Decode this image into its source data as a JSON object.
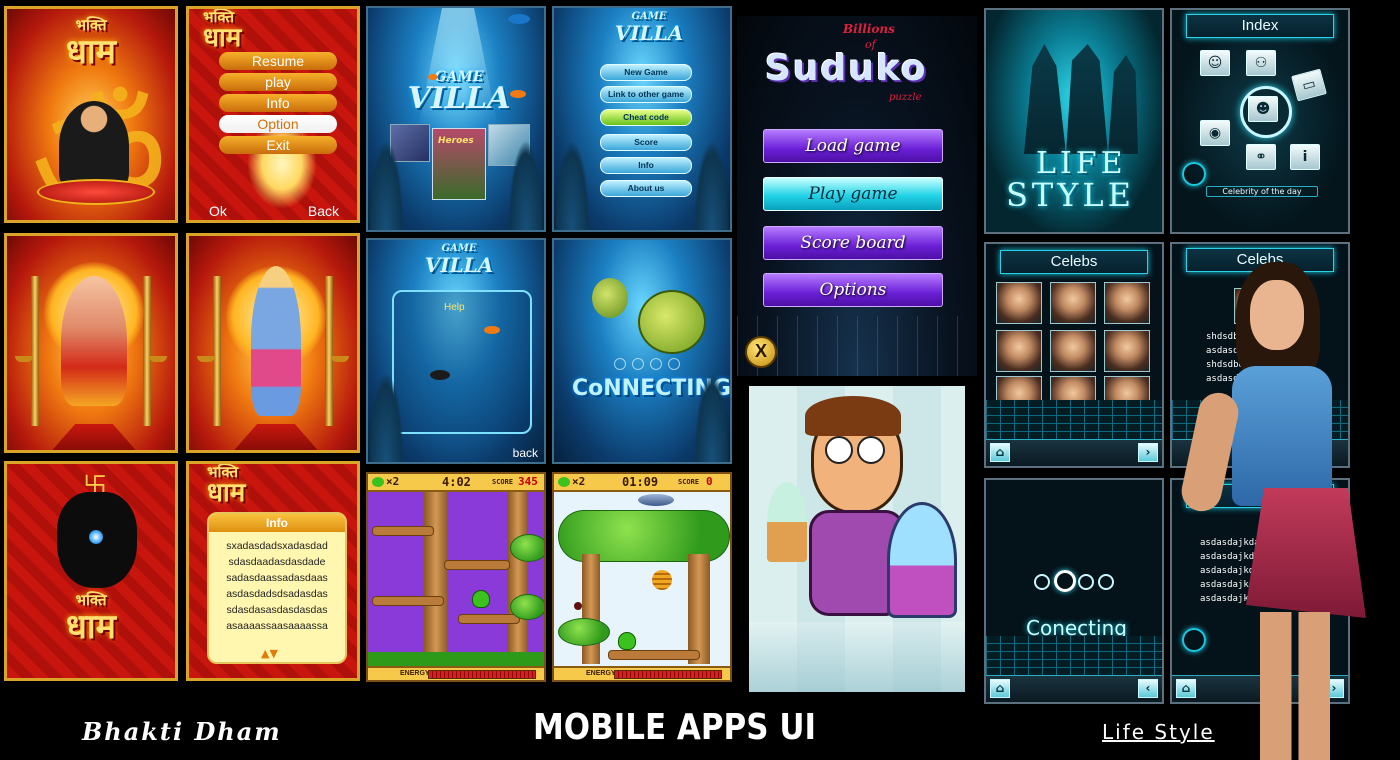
{
  "banner": {
    "title": "MOBILE APPS UI",
    "left_caption": "Bhakti Dham",
    "right_caption": "Life Style"
  },
  "bhakti_dham": {
    "title_small": "भक्ति",
    "title_big": "धाम",
    "om_symbol": "ॐ",
    "menu": [
      "Resume",
      "play",
      "Info",
      "Option",
      "Exit"
    ],
    "selected_menu": "Option",
    "softkey_left": "Ok",
    "softkey_right": "Back",
    "info_title": "Info",
    "info_lines": [
      "sxadasdadsxadasdad",
      "sdasdaadasdasdade",
      "sadasdaassadasdaas",
      "asdasdadsdsadasdas",
      "sdasdasasdasdasdas",
      "asaaaassaasaaaassa"
    ],
    "info_arrows": "▲▼",
    "swastika": "卐"
  },
  "game_villa": {
    "logo_top": "GAME",
    "logo_bottom": "VILLA",
    "heroes_label": "Heroes",
    "menu": [
      "New Game",
      "Link to other game",
      "Cheat code",
      "Score",
      "Info",
      "About us"
    ],
    "selected_menu": "Cheat code",
    "help_label": "Help",
    "back_label": "back",
    "connecting_label": "CoNNECTING"
  },
  "platform_game": {
    "screen1": {
      "lives": "×2",
      "time": "4:02",
      "score_label": "SCORE",
      "score": "345",
      "energy_label": "ENERGY"
    },
    "screen2": {
      "lives": "×2",
      "time": "01:09",
      "score_label": "SCORE",
      "score": "0",
      "energy_label": "ENERGY"
    }
  },
  "suduko": {
    "title_top": "Billions",
    "title_of": "of",
    "title_main": "Suduko",
    "title_sub": "puzzle",
    "buttons": [
      "Load game",
      "Play game",
      "Score board",
      "Options"
    ],
    "selected_button": "Play game",
    "close_label": "X"
  },
  "life_style": {
    "logo_top": "LIFE",
    "logo_bottom": "STYLE",
    "index_title": "Index",
    "celebrity_label": "Celebrity of the day",
    "celebs_title": "Celebs",
    "celebs_detail_lines": [
      "shdsdbd",
      "asdasdas",
      "shdsdbd",
      "asdasdas"
    ],
    "connecting_label": "Conecting",
    "help_title": "He",
    "help_lines": [
      "asdasdajkdaj",
      "asdasdajkdaj",
      "asdasdajkdaj",
      "asdasdajkdaj",
      "asdasdajkdaj"
    ],
    "home_icon": "⌂",
    "back_icon": "‹",
    "next_icon": "›"
  },
  "colors": {
    "bhakti_border": "#d9a428",
    "villa_blue": "#1b7fc2",
    "suduko_purple": "#6a1fd6",
    "suduko_cyan": "#22d3e6",
    "lifestyle_cyan": "#2ad2e8"
  }
}
